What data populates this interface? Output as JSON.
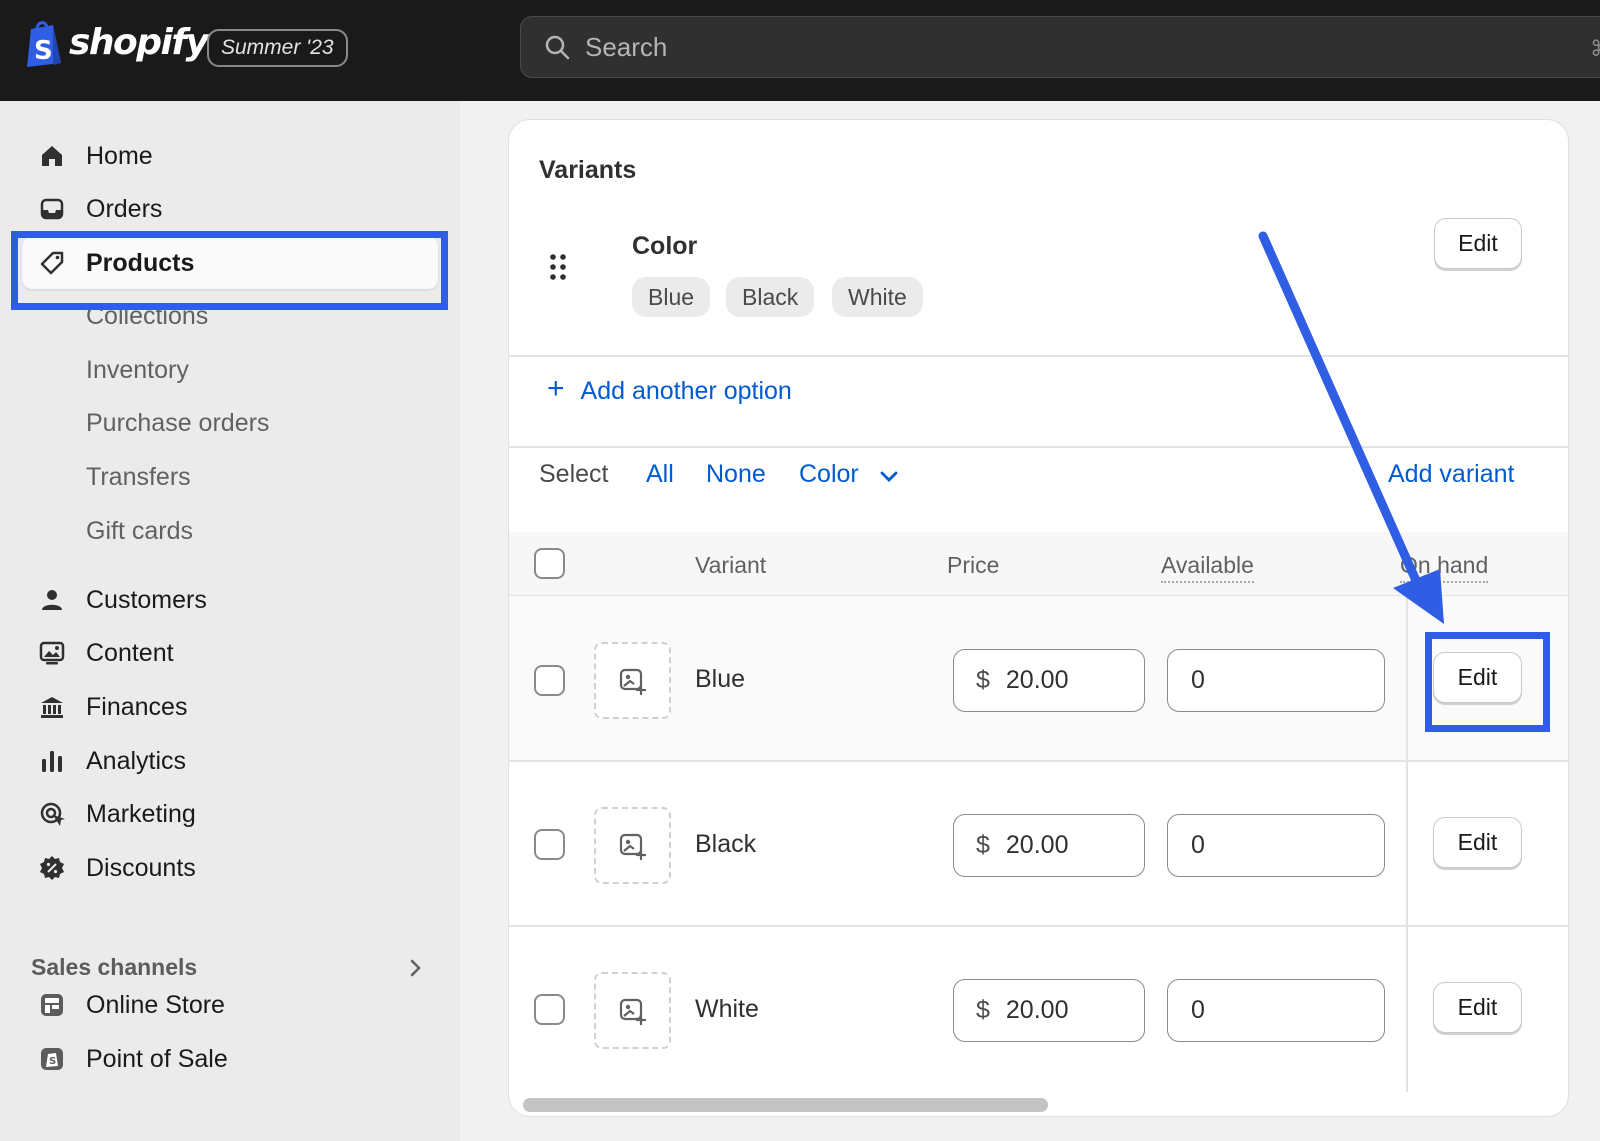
{
  "topbar": {
    "brand": "shopify",
    "edition_badge": "Summer '23",
    "search_placeholder": "Search",
    "shortcut_glyph": "⌘"
  },
  "sidebar": {
    "items": [
      {
        "label": "Home",
        "icon": "home-icon"
      },
      {
        "label": "Orders",
        "icon": "inbox-icon"
      },
      {
        "label": "Products",
        "icon": "tag-icon",
        "active": true
      },
      {
        "label": "Collections",
        "sub": true
      },
      {
        "label": "Inventory",
        "sub": true
      },
      {
        "label": "Purchase orders",
        "sub": true
      },
      {
        "label": "Transfers",
        "sub": true
      },
      {
        "label": "Gift cards",
        "sub": true
      },
      {
        "label": "Customers",
        "icon": "person-icon"
      },
      {
        "label": "Content",
        "icon": "image-icon"
      },
      {
        "label": "Finances",
        "icon": "bank-icon"
      },
      {
        "label": "Analytics",
        "icon": "bar-chart-icon"
      },
      {
        "label": "Marketing",
        "icon": "target-icon"
      },
      {
        "label": "Discounts",
        "icon": "discount-icon"
      }
    ],
    "section_title": "Sales channels",
    "channels": [
      {
        "label": "Online Store",
        "icon": "store-icon"
      },
      {
        "label": "Point of Sale",
        "icon": "pos-icon"
      }
    ]
  },
  "variants_card": {
    "title": "Variants",
    "option": {
      "name": "Color",
      "values": [
        "Blue",
        "Black",
        "White"
      ],
      "edit_label": "Edit"
    },
    "add_option_label": "Add another option",
    "select_bar": {
      "label": "Select",
      "all": "All",
      "none": "None",
      "color": "Color",
      "add_variant": "Add variant"
    },
    "columns": [
      "Variant",
      "Price",
      "Available",
      "On hand"
    ],
    "rows": [
      {
        "name": "Blue",
        "currency": "$",
        "price": "20.00",
        "available": "0",
        "action": "Edit"
      },
      {
        "name": "Black",
        "currency": "$",
        "price": "20.00",
        "available": "0",
        "action": "Edit"
      },
      {
        "name": "White",
        "currency": "$",
        "price": "20.00",
        "available": "0",
        "action": "Edit"
      }
    ]
  },
  "colors": {
    "topbar_bg": "#1a1a1a",
    "link": "#005bd3",
    "annotation": "#2f5de3"
  }
}
